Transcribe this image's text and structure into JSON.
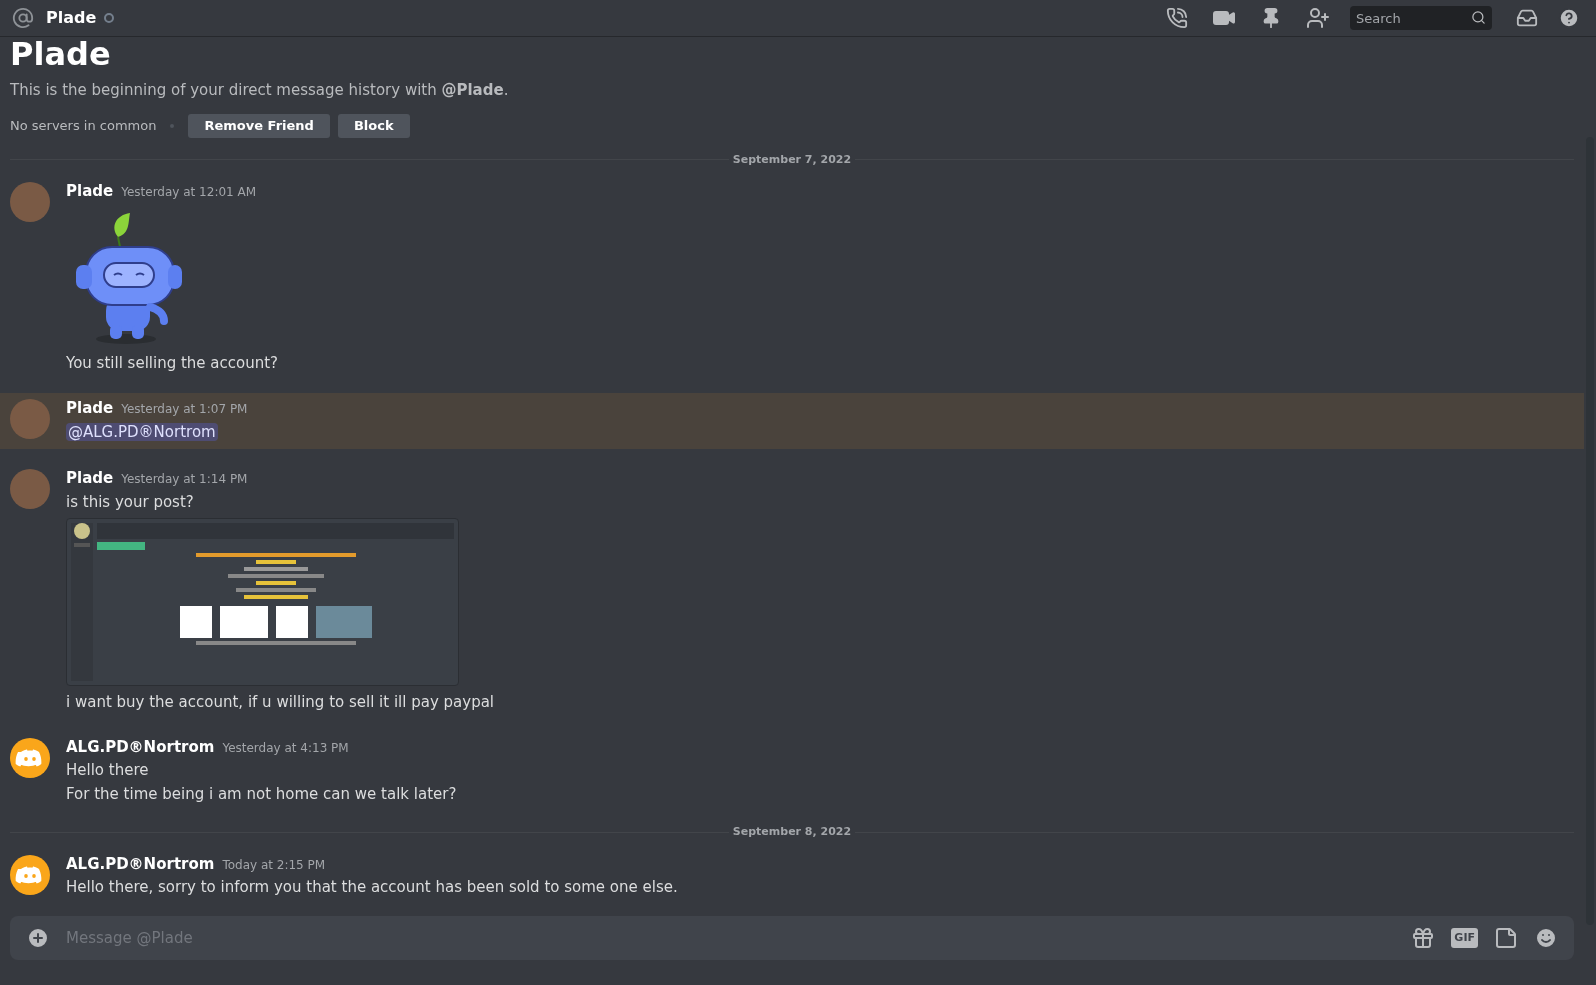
{
  "header": {
    "channel_name": "Plade",
    "status": {
      "kind": "offline"
    },
    "search": {
      "placeholder": "Search"
    }
  },
  "intro": {
    "title": "Plade",
    "text": "This is the beginning of your direct message history with **@Plade**.",
    "mutual": "No servers in common",
    "buttons": [
      "Remove Friend",
      "Block"
    ]
  },
  "messages": [
    {
      "kind": "divider",
      "date": "September 7, 2022"
    },
    {
      "kind": "message",
      "author": "Plade",
      "avatar": {
        "kind": "photo"
      },
      "time": "Yesterday at 12:01 AM",
      "highlighted": false,
      "parts": [
        {
          "kind": "sticker"
        },
        {
          "kind": "text",
          "text": "You still selling the account?"
        }
      ]
    },
    {
      "kind": "message",
      "author": "Plade",
      "avatar": {
        "kind": "photo"
      },
      "time": "Yesterday at 1:07 PM",
      "highlighted": true,
      "parts": [
        {
          "kind": "mention",
          "text": "@ALG.PD®Nortrom"
        }
      ]
    },
    {
      "kind": "message",
      "author": "Plade",
      "avatar": {
        "kind": "photo"
      },
      "time": "Yesterday at 1:14 PM",
      "highlighted": false,
      "parts": [
        {
          "kind": "text",
          "text": "is this your post?"
        },
        {
          "kind": "image"
        },
        {
          "kind": "text",
          "text": "i want buy the account, if u willing to sell it ill pay paypal"
        }
      ]
    },
    {
      "kind": "message",
      "author": "ALG.PD®Nortrom",
      "avatar": {
        "kind": "app"
      },
      "time": "Yesterday at 4:13 PM",
      "highlighted": false,
      "parts": [
        {
          "kind": "text",
          "text": "Hello there"
        },
        {
          "kind": "text",
          "text": "For the time being i am not home can we talk later?"
        }
      ]
    },
    {
      "kind": "divider",
      "date": "September 8, 2022"
    },
    {
      "kind": "message",
      "author": "ALG.PD®Nortrom",
      "avatar": {
        "kind": "app"
      },
      "time": "Today at 2:15 PM",
      "highlighted": false,
      "parts": [
        {
          "kind": "text",
          "text": "Hello there, sorry to inform you that the account has been sold to some one else."
        }
      ]
    }
  ],
  "composer": {
    "placeholder": "Message @Plade",
    "gif_label": "GIF"
  }
}
